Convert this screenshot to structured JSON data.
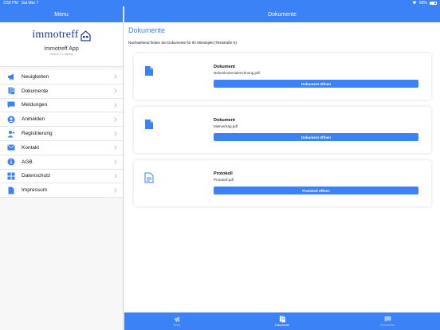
{
  "status_bar": {
    "time": "3:58 PM",
    "date": "Sat Mar 7",
    "battery": "69%"
  },
  "sidebar": {
    "title": "Menu",
    "logo_text": "immotreff",
    "logo_subtext": "",
    "app_name": "Immotreff App",
    "app_version": "Version 0.1 (alpha)",
    "items": [
      {
        "label": "Neuigkeiten",
        "icon": "megaphone-icon"
      },
      {
        "label": "Dokumente",
        "icon": "document-icon"
      },
      {
        "label": "Meldungen",
        "icon": "message-icon"
      },
      {
        "label": "Anmelden",
        "icon": "user-circle-icon"
      },
      {
        "label": "Registrierung",
        "icon": "add-user-icon"
      },
      {
        "label": "Kontakt",
        "icon": "mail-icon"
      },
      {
        "label": "AGB",
        "icon": "info-icon"
      },
      {
        "label": "Datenschutz",
        "icon": "grid-icon"
      },
      {
        "label": "Impressum",
        "icon": "file-icon"
      }
    ]
  },
  "main": {
    "header_title": "Dokumente",
    "page_title": "Dokumente",
    "intro": "Nachstehend finden Sie Dokumente für Ihr Mietobjekt (Teststraße 5).",
    "documents": [
      {
        "title": "Dokument",
        "file": "Nebenkostenabrechnung.pdf",
        "button": "Dokument öffnen",
        "icon": "document-filled-icon"
      },
      {
        "title": "Dokument",
        "file": "Mietvertrag.pdf",
        "button": "Dokument öffnen",
        "icon": "document-filled-icon"
      },
      {
        "title": "Protokoll",
        "file": "Protokoll.pdf",
        "button": "Protokoll öffnen",
        "icon": "document-outline-icon"
      }
    ]
  },
  "tabbar": {
    "tabs": [
      {
        "label": "News",
        "icon": "megaphone-icon",
        "active": false
      },
      {
        "label": "Dokumente",
        "icon": "documents-icon",
        "active": true
      },
      {
        "label": "Kommentar",
        "icon": "comment-icon",
        "active": false
      }
    ]
  },
  "colors": {
    "accent": "#3b82f6",
    "logo": "#1e3a8a"
  }
}
